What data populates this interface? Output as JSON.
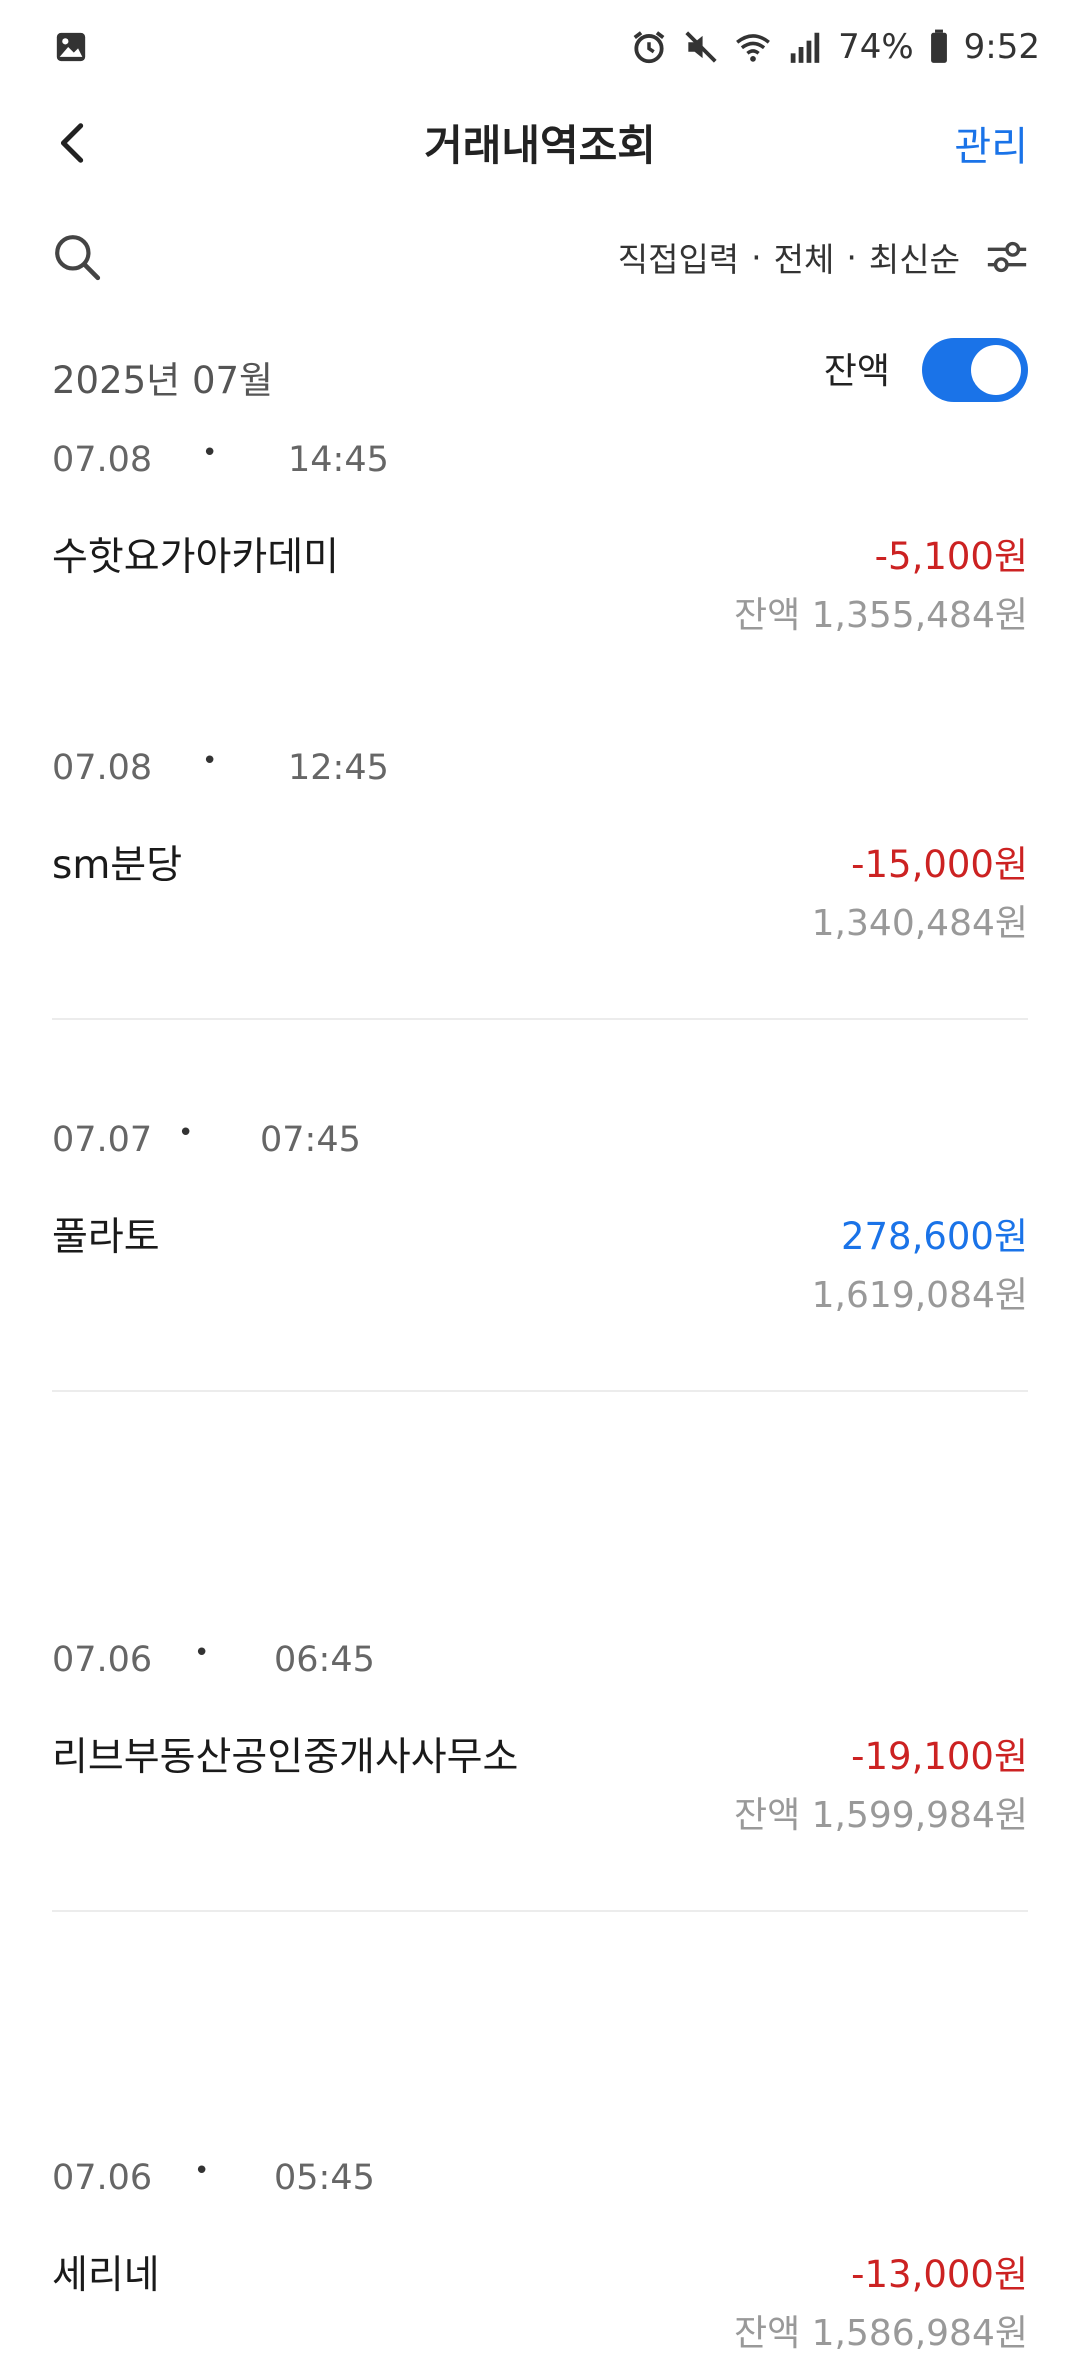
{
  "status_bar": {
    "battery": "74%",
    "time": "9:52"
  },
  "header": {
    "title": "거래내역조회",
    "manage_label": "관리"
  },
  "filters": {
    "type": "직접입력",
    "range": "전체",
    "sort": "최신순",
    "separator": "·"
  },
  "month": {
    "label": "2025년 07월",
    "balance_toggle_label": "잔액",
    "balance_toggle_on": true
  },
  "transactions": [
    {
      "date": "07.08",
      "time": "14:45",
      "name": "수핫요가아카데미",
      "amount": "-5,100원",
      "direction": "out",
      "balance": "잔액 1,355,484원"
    },
    {
      "date": "07.08",
      "time": "12:45",
      "name": "sm분당",
      "amount": "-15,000원",
      "direction": "out",
      "balance": "1,340,484원"
    },
    {
      "date": "07.07",
      "time": "07:45",
      "name": "풀라토",
      "amount": "278,600원",
      "direction": "in",
      "balance": "1,619,084원"
    },
    {
      "date": "07.06",
      "time": "06:45",
      "name": "리브부동산공인중개사사무소",
      "amount": "-19,100원",
      "direction": "out",
      "balance": "잔액 1,599,984원"
    },
    {
      "date": "07.06",
      "time": "05:45",
      "name": "세리네",
      "amount": "-13,000원",
      "direction": "out",
      "balance": "잔액 1,586,984원"
    }
  ],
  "colors": {
    "accent": "#1a73e8",
    "negative": "#cc2222",
    "muted": "#999999"
  },
  "icons": [
    "gallery-icon",
    "alarm-icon",
    "mute-icon",
    "wifi-icon",
    "signal-icon",
    "battery-icon",
    "back-arrow-icon",
    "search-icon",
    "filter-sliders-icon"
  ]
}
